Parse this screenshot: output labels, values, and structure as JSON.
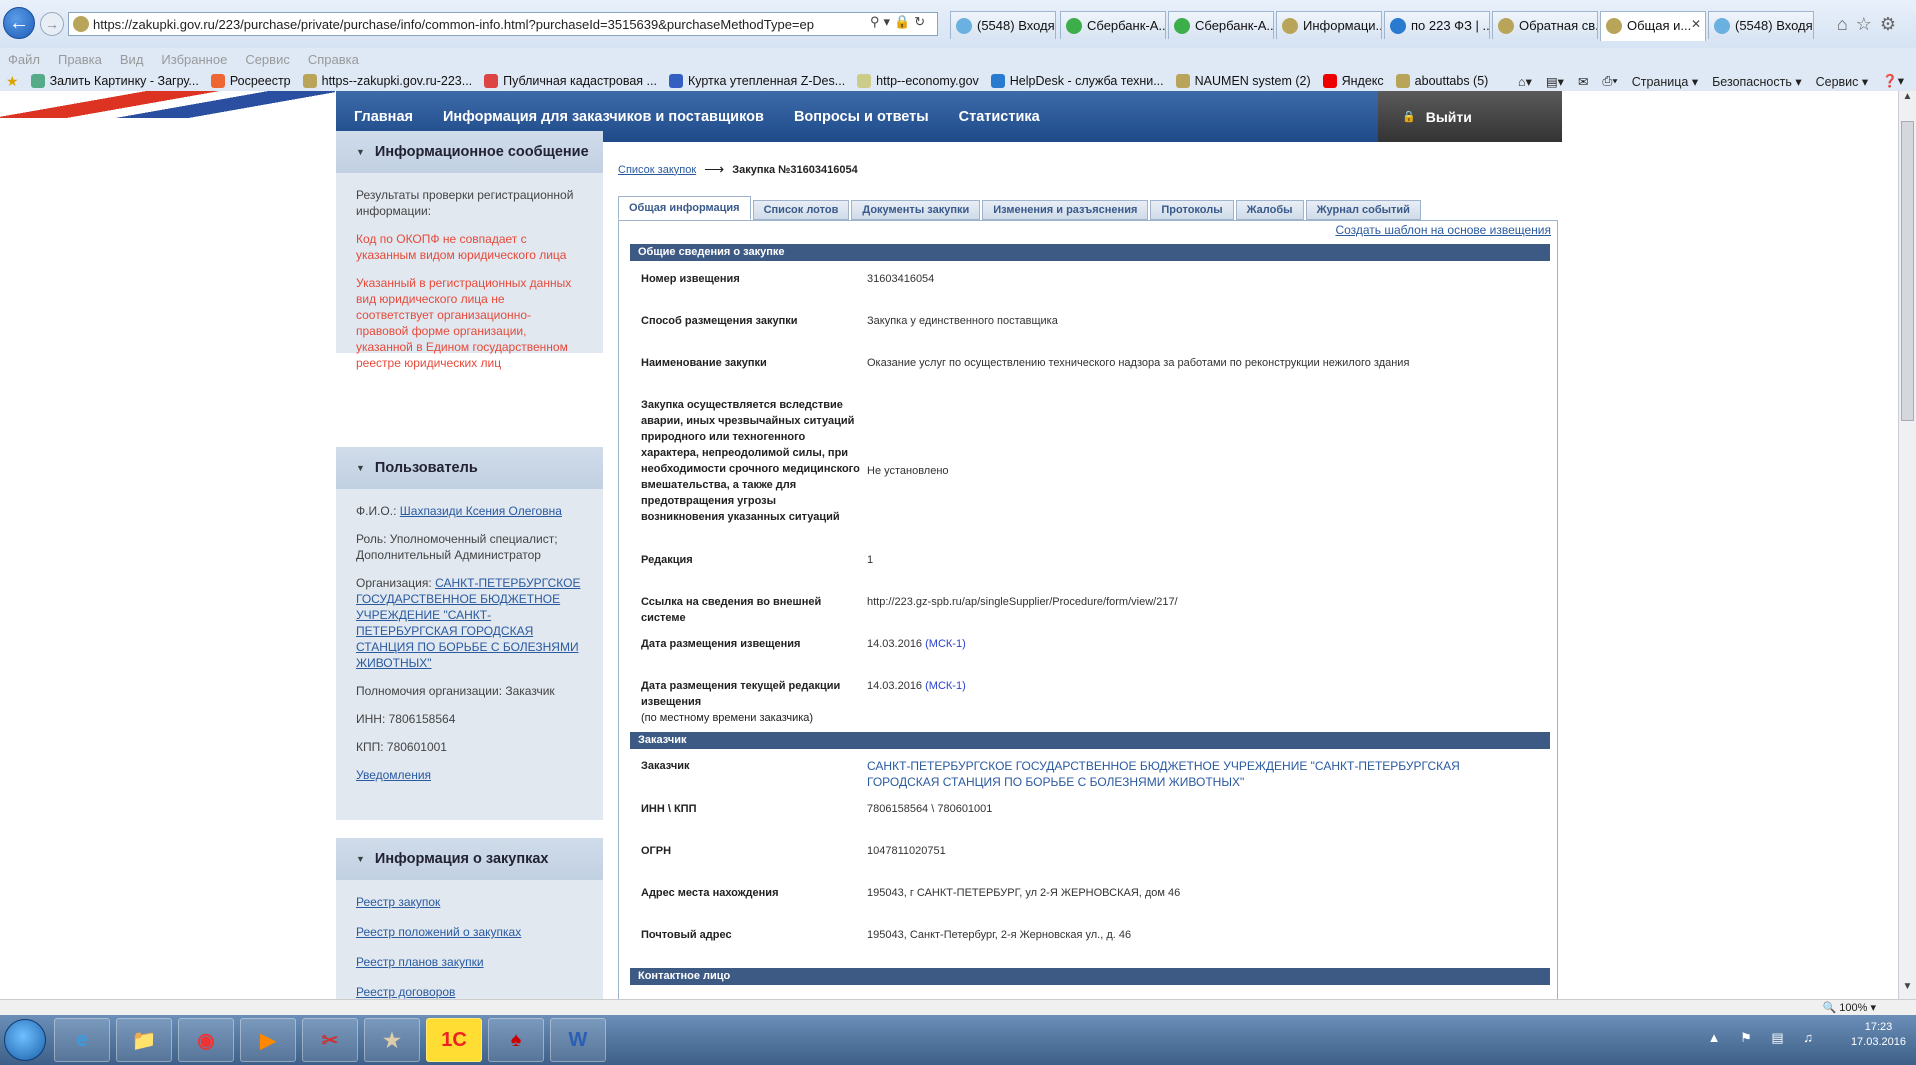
{
  "browser": {
    "url": "https://zakupki.gov.ru/223/purchase/private/purchase/info/common-info.html?purchaseId=3515639&purchaseMethodType=ep",
    "tabs": [
      {
        "label": "(5548) Входя..."
      },
      {
        "label": "Сбербанк-А..."
      },
      {
        "label": "Сбербанк-А..."
      },
      {
        "label": "Информаци..."
      },
      {
        "label": "по 223 ФЗ | ..."
      },
      {
        "label": "Обратная св..."
      },
      {
        "label": "Общая и...",
        "active": true
      },
      {
        "label": "(5548) Входя..."
      }
    ],
    "menu": [
      "Файл",
      "Правка",
      "Вид",
      "Избранное",
      "Сервис",
      "Справка"
    ],
    "favorites": [
      "Залить Картинку - Загру...",
      "Росреестр",
      "https--zakupki.gov.ru-223...",
      "Публичная кадастровая ...",
      "Куртка утепленная Z-Des...",
      "http--economy.gov",
      "HelpDesk - служба техни...",
      "NAUMEN system (2)",
      "Яндекс",
      "abouttabs (5)"
    ],
    "commands": [
      "Страница",
      "Безопасность",
      "Сервис"
    ],
    "zoom": "100%"
  },
  "nav": {
    "items": [
      "Главная",
      "Информация для заказчиков и поставщиков",
      "Вопросы и ответы",
      "Статистика"
    ],
    "logout": "Выйти"
  },
  "sidebar": {
    "info": {
      "title": "Информационное сообщение",
      "intro": "Результаты проверки регистрационной информации:",
      "errors": [
        "Код по ОКОПФ не совпадает с указанным видом юридического лица",
        "Указанный в регистрационных данных вид юридического лица не соответствует организационно-правовой форме организации, указанной в Едином государственном реестре юридических лиц"
      ]
    },
    "user": {
      "title": "Пользователь",
      "fio_label": "Ф.И.О.:",
      "fio": "Шахпазиди Ксения Олеговна",
      "role": "Роль: Уполномоченный специалист; Дополнительный Администратор",
      "org_label": "Организация:",
      "org": "САНКТ-ПЕТЕРБУРГСКОЕ ГОСУДАРСТВЕННОЕ БЮДЖЕТНОЕ УЧРЕЖДЕНИЕ \"САНКТ-ПЕТЕРБУРГСКАЯ ГОРОДСКАЯ СТАНЦИЯ ПО БОРЬБЕ С БОЛЕЗНЯМИ ЖИВОТНЫХ\"",
      "powers": "Полномочия организации: Заказчик",
      "inn": "ИНН: 7806158564",
      "kpp": "КПП: 780601001",
      "notifications": "Уведомления"
    },
    "purchases": {
      "title": "Информация о закупках",
      "links": [
        "Реестр закупок",
        "Реестр положений о закупках",
        "Реестр планов закупки",
        "Реестр договоров"
      ]
    }
  },
  "breadcrumb": {
    "link": "Список закупок",
    "current": "Закупка №31603416054"
  },
  "content_tabs": [
    "Общая информация",
    "Список лотов",
    "Документы закупки",
    "Изменения и разъяснения",
    "Протоколы",
    "Жалобы",
    "Журнал событий"
  ],
  "template_link": "Создать шаблон на основе извещения",
  "section_general": {
    "title": "Общие сведения о закупке",
    "rows": [
      {
        "label": "Номер извещения",
        "value": "31603416054"
      },
      {
        "label": "Способ размещения закупки",
        "value": "Закупка у единственного поставщика"
      },
      {
        "label": "Наименование закупки",
        "value": "Оказание услуг по осуществлению технического надзора за работами по реконструкции нежилого здания"
      },
      {
        "label": "Закупка осуществляется вследствие аварии, иных чрезвычайных ситуаций природного или техногенного характера, непреодолимой силы, при необходимости срочного медицинского вмешательства, а также для предотвращения угрозы возникновения указанных ситуаций",
        "value": "Не установлено"
      },
      {
        "label": "Редакция",
        "value": "1"
      },
      {
        "label": "Ссылка на сведения во внешней системе",
        "value": "http://223.gz-spb.ru/ap/singleSupplier/Procedure/form/view/217/"
      },
      {
        "label": "Дата размещения извещения",
        "value": "14.03.2016",
        "tz": "(МСК-1)"
      },
      {
        "label": "Дата размещения текущей редакции извещения",
        "note": "(по местному времени заказчика)",
        "value": "14.03.2016",
        "tz": "(МСК-1)"
      }
    ]
  },
  "section_customer": {
    "title": "Заказчик",
    "rows": [
      {
        "label": "Заказчик",
        "value": "САНКТ-ПЕТЕРБУРГСКОЕ ГОСУДАРСТВЕННОЕ БЮДЖЕТНОЕ УЧРЕЖДЕНИЕ \"САНКТ-ПЕТЕРБУРГСКАЯ ГОРОДСКАЯ СТАНЦИЯ ПО БОРЬБЕ С БОЛЕЗНЯМИ ЖИВОТНЫХ\""
      },
      {
        "label": "ИНН \\ КПП",
        "value": "7806158564 \\ 780601001"
      },
      {
        "label": "ОГРН",
        "value": "1047811020751"
      },
      {
        "label": "Адрес места нахождения",
        "value": "195043, г САНКТ-ПЕТЕРБУРГ, ул 2-Я ЖЕРНОВСКАЯ, дом 46"
      },
      {
        "label": "Почтовый адрес",
        "value": "195043, Санкт-Петербург, 2-я Жерновская ул., д. 46"
      }
    ]
  },
  "section_contact": {
    "title": "Контактное лицо"
  },
  "taskbar": {
    "time": "17:23",
    "date": "17.03.2016",
    "app_label": "1С"
  }
}
